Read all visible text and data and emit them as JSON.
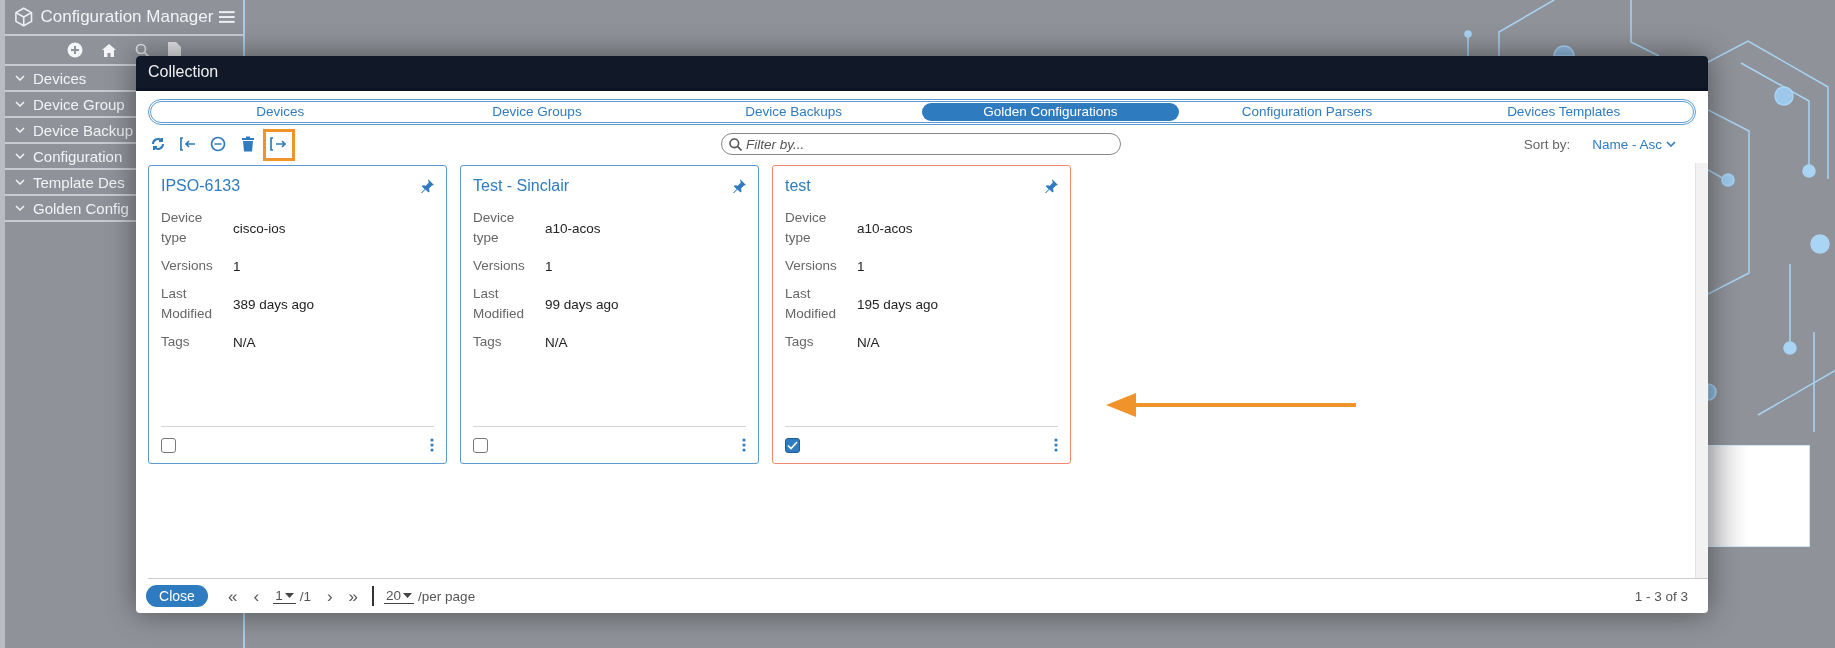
{
  "sidebar": {
    "title": "Configuration Manager",
    "items": [
      {
        "label": "Devices"
      },
      {
        "label": "Device Group"
      },
      {
        "label": "Device Backup"
      },
      {
        "label": "Configuration"
      },
      {
        "label": "Template Des"
      },
      {
        "label": "Golden Config"
      }
    ]
  },
  "modal": {
    "title": "Collection",
    "tabs": [
      {
        "label": "Devices",
        "selected": false
      },
      {
        "label": "Device Groups",
        "selected": false
      },
      {
        "label": "Device Backups",
        "selected": false
      },
      {
        "label": "Golden Configurations",
        "selected": true
      },
      {
        "label": "Configuration Parsers",
        "selected": false
      },
      {
        "label": "Devices Templates",
        "selected": false
      }
    ],
    "toolbar": [
      {
        "kind": "refresh",
        "highlighted": false
      },
      {
        "kind": "import",
        "highlighted": false
      },
      {
        "kind": "remove",
        "highlighted": false
      },
      {
        "kind": "delete",
        "highlighted": false
      },
      {
        "kind": "export",
        "highlighted": true
      }
    ],
    "filter": {
      "placeholder": "Filter by..."
    },
    "sort": {
      "label": "Sort by:",
      "value": "Name - Asc"
    },
    "cards": [
      {
        "title": "IPSO-6133",
        "checked": false,
        "fields": [
          {
            "label": "Device type",
            "value": "cisco-ios"
          },
          {
            "label": "Versions",
            "value": "1"
          },
          {
            "label": "Last Modified",
            "value": "389 days ago"
          },
          {
            "label": "Tags",
            "value": "N/A"
          }
        ]
      },
      {
        "title": "Test - Sinclair",
        "checked": false,
        "fields": [
          {
            "label": "Device type",
            "value": "a10-acos"
          },
          {
            "label": "Versions",
            "value": "1"
          },
          {
            "label": "Last Modified",
            "value": "99 days ago"
          },
          {
            "label": "Tags",
            "value": "N/A"
          }
        ]
      },
      {
        "title": "test",
        "checked": true,
        "fields": [
          {
            "label": "Device type",
            "value": "a10-acos"
          },
          {
            "label": "Versions",
            "value": "1"
          },
          {
            "label": "Last Modified",
            "value": "195 days ago"
          },
          {
            "label": "Tags",
            "value": "N/A"
          }
        ]
      }
    ],
    "footer": {
      "close": "Close",
      "first": "«",
      "prev": "‹",
      "page": "1",
      "pages": "/1",
      "next": "›",
      "last": "»",
      "per_page": "20",
      "per_page_label": "/per page",
      "range": "1 - 3 of 3"
    }
  }
}
